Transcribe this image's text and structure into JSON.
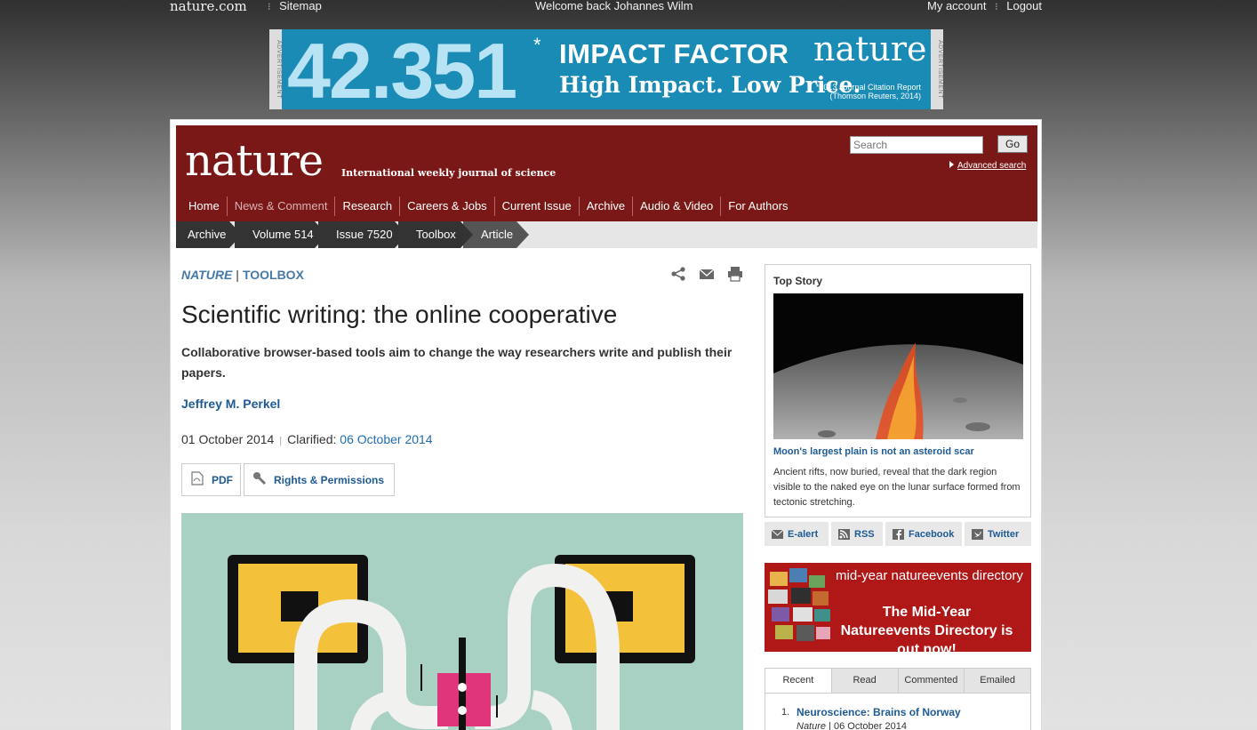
{
  "topbar": {
    "logo": "nature.com",
    "sitemap": "Sitemap",
    "welcome": "Welcome back Johannes Wilm",
    "my_account": "My account",
    "logout": "Logout",
    "separator": "⁝"
  },
  "ad": {
    "side_label": "ADVERTISEMENT",
    "number": "42.351",
    "star": "*",
    "headline": "IMPACT FACTOR",
    "slogan": "High Impact. Low Price.",
    "brand": "nature",
    "jcr_line1": "*2013 Journal Citation Report",
    "jcr_line2": "(Thomson Reuters, 2014)"
  },
  "header": {
    "brand": "nature",
    "tagline": "International weekly journal of science",
    "search_placeholder": "Search",
    "go_label": "Go",
    "advanced_search": "Advanced search"
  },
  "nav": [
    {
      "label": "Home",
      "active": false
    },
    {
      "label": "News & Comment",
      "active": true
    },
    {
      "label": "Research",
      "active": false
    },
    {
      "label": "Careers & Jobs",
      "active": false
    },
    {
      "label": "Current Issue",
      "active": false
    },
    {
      "label": "Archive",
      "active": false
    },
    {
      "label": "Audio & Video",
      "active": false
    },
    {
      "label": "For Authors",
      "active": false
    }
  ],
  "breadcrumbs": [
    "Archive",
    "Volume 514",
    "Issue 7520",
    "Toolbox",
    "Article"
  ],
  "article": {
    "journal": "NATURE",
    "section": "TOOLBOX",
    "kicker_sep": "|",
    "title": "Scientific writing: the online cooperative",
    "standfirst": "Collaborative browser-based tools aim to change the way researchers write and publish their papers.",
    "author": "Jeffrey M. Perkel",
    "date": "01 October 2014",
    "date_sep": "|",
    "clarified_label": "Clarified:",
    "clarified_date": "06 October 2014",
    "pdf_label": "PDF",
    "rights_label": "Rights & Permissions"
  },
  "sidebar": {
    "top_story_label": "Top Story",
    "top_story_headline": "Moon's largest plain is not an asteroid scar",
    "top_story_desc": "Ancient rifts, now buried, reveal that the dark region visible to the naked eye on the lunar surface formed from tectonic stretching.",
    "social": [
      "E-alert",
      "RSS",
      "Facebook",
      "Twitter"
    ],
    "events_line1": "mid-year natureevents directory",
    "events_line2": "The Mid-Year Natureevents Directory is out now!",
    "tabs": [
      "Recent",
      "Read",
      "Commented",
      "Emailed"
    ],
    "active_tab": "Recent",
    "list": [
      {
        "num": "1.",
        "title": "Neuroscience: Brains of Norway",
        "journal": "Nature",
        "sep": "|",
        "date": "06 October 2014"
      }
    ]
  },
  "colors": {
    "header_red": "#7a1818",
    "link_blue": "#1e5a93",
    "crumb_dark": "#333333",
    "ad_blue": "#1a8bb5"
  }
}
